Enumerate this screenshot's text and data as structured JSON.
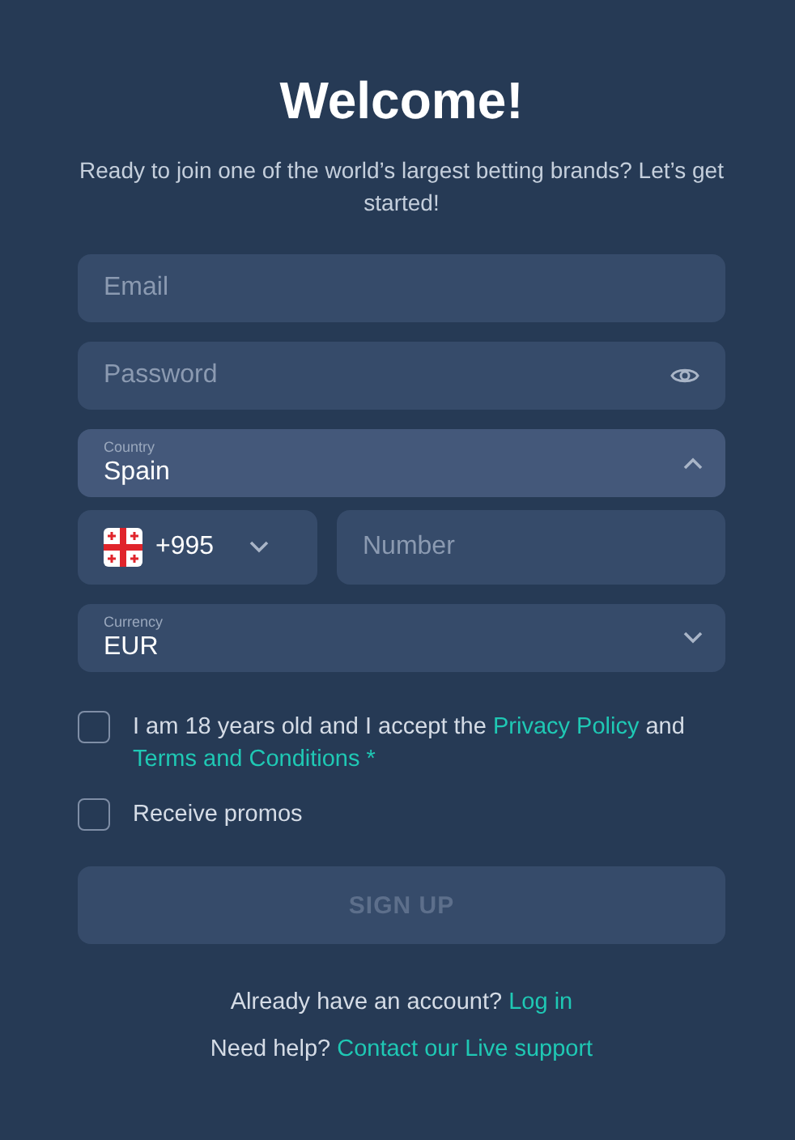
{
  "title": "Welcome!",
  "subtitle": "Ready to join one of the world’s largest betting brands? Let’s get started!",
  "fields": [
    {
      "kind": "text",
      "placeholder": "Email"
    },
    {
      "kind": "password",
      "placeholder": "Password"
    },
    {
      "kind": "select",
      "label": "Country",
      "value": "Spain",
      "expanded": true
    },
    {
      "kind": "phone",
      "code": "+995",
      "placeholder": "Number"
    },
    {
      "kind": "select",
      "label": "Currency",
      "value": "EUR",
      "expanded": false
    }
  ],
  "consents": [
    {
      "checked": false,
      "parts": [
        {
          "text": "I am 18 years old and I accept the ",
          "link": false
        },
        {
          "text": "Privacy Policy",
          "link": true
        },
        {
          "text": " and ",
          "link": false
        },
        {
          "text": "Terms and Conditions *",
          "link": true
        }
      ]
    },
    {
      "checked": false,
      "parts": [
        {
          "text": "Receive promos",
          "link": false
        }
      ]
    }
  ],
  "submit": {
    "label": "SIGN UP",
    "disabled": true
  },
  "footer": [
    [
      {
        "text": "Already have an account? ",
        "link": false
      },
      {
        "text": "Log in",
        "link": true
      }
    ],
    [
      {
        "text": "Need help? ",
        "link": false
      },
      {
        "text": "Contact our Live support",
        "link": true
      }
    ]
  ]
}
